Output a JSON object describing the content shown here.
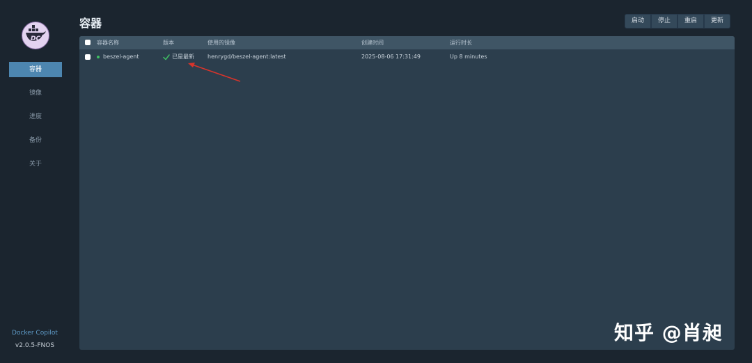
{
  "page": {
    "title": "容器"
  },
  "sidebar": {
    "items": [
      {
        "label": "容器"
      },
      {
        "label": "镜像"
      },
      {
        "label": "进度"
      },
      {
        "label": "备份"
      },
      {
        "label": "关于"
      }
    ],
    "brand": "Docker Copilot",
    "version": "v2.0.5-FNOS"
  },
  "toolbar": {
    "start_label": "启动",
    "stop_label": "停止",
    "restart_label": "重启",
    "update_label": "更新"
  },
  "table": {
    "columns": [
      "容器名称",
      "版本",
      "使用的镜像",
      "创建时间",
      "运行时长"
    ],
    "rows": [
      {
        "name": "beszel-agent",
        "version": "已是最新",
        "image": "henrygd/beszel-agent:latest",
        "created": "2025-08-06 17:31:49",
        "uptime": "Up 8 minutes"
      }
    ]
  },
  "watermark": "知乎 @肖昶",
  "colors": {
    "accent": "#4d86b0",
    "background": "#1b252f",
    "panel": "#2c3e4d",
    "status_running": "#3fbf62",
    "annotation_arrow": "#d9342b"
  }
}
